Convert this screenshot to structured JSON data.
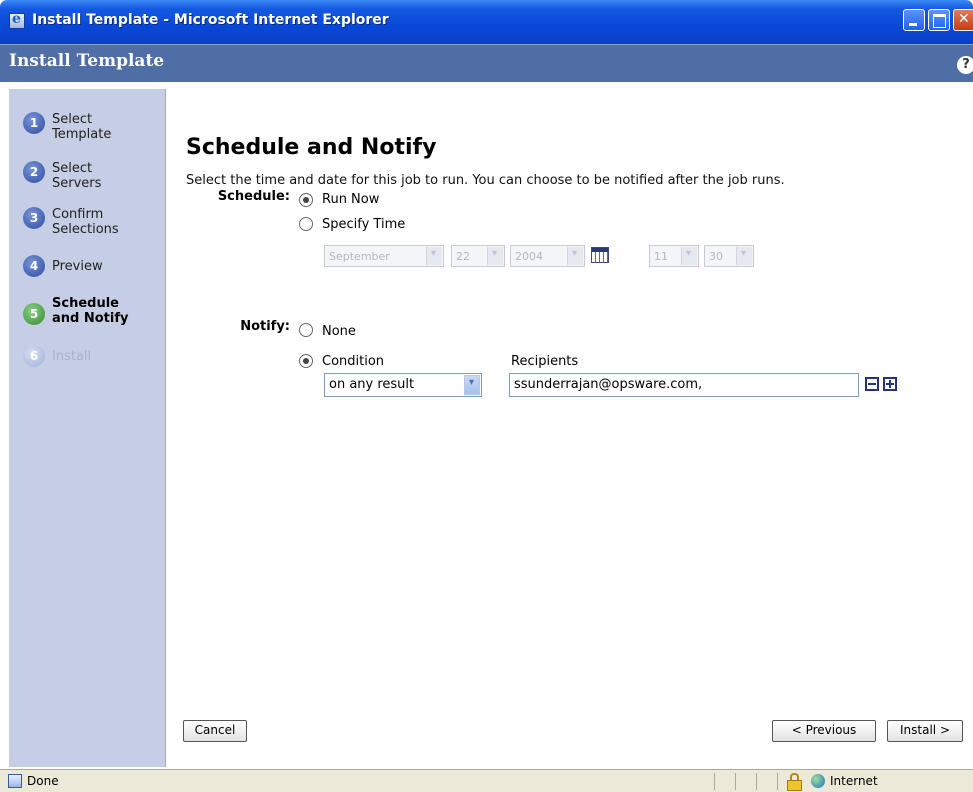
{
  "window": {
    "title": "Install Template - Microsoft Internet Explorer"
  },
  "header": {
    "title": "Install Template",
    "help_icon": "?"
  },
  "steps": [
    {
      "number": "1",
      "label": "Select Template",
      "state": "done"
    },
    {
      "number": "2",
      "label": "Select Servers",
      "state": "done"
    },
    {
      "number": "3",
      "label": "Confirm Selections",
      "state": "done"
    },
    {
      "number": "4",
      "label": "Preview",
      "state": "done"
    },
    {
      "number": "5",
      "label": "Schedule and Notify",
      "state": "current"
    },
    {
      "number": "6",
      "label": "Install",
      "state": "disabled"
    }
  ],
  "main": {
    "title": "Schedule and Notify",
    "subtitle": "Select the time and date for this job to run. You can choose to be notified after the job runs."
  },
  "schedule": {
    "label": "Schedule:",
    "run_now": "Run Now",
    "specify_time": "Specify Time",
    "selected": "Run Now",
    "month": "September",
    "day": "22",
    "year": "2004",
    "hour": "11",
    "minute": "30"
  },
  "notify": {
    "label": "Notify:",
    "none": "None",
    "condition": "Condition",
    "selected": "Condition",
    "condition_value": "on any result",
    "recipients_label": "Recipients",
    "recipients_value": "ssunderrajan@opsware.com,"
  },
  "buttons": {
    "cancel": "Cancel",
    "previous": "< Previous",
    "install": "Install >"
  },
  "statusbar": {
    "status": "Done",
    "zone": "Internet"
  }
}
